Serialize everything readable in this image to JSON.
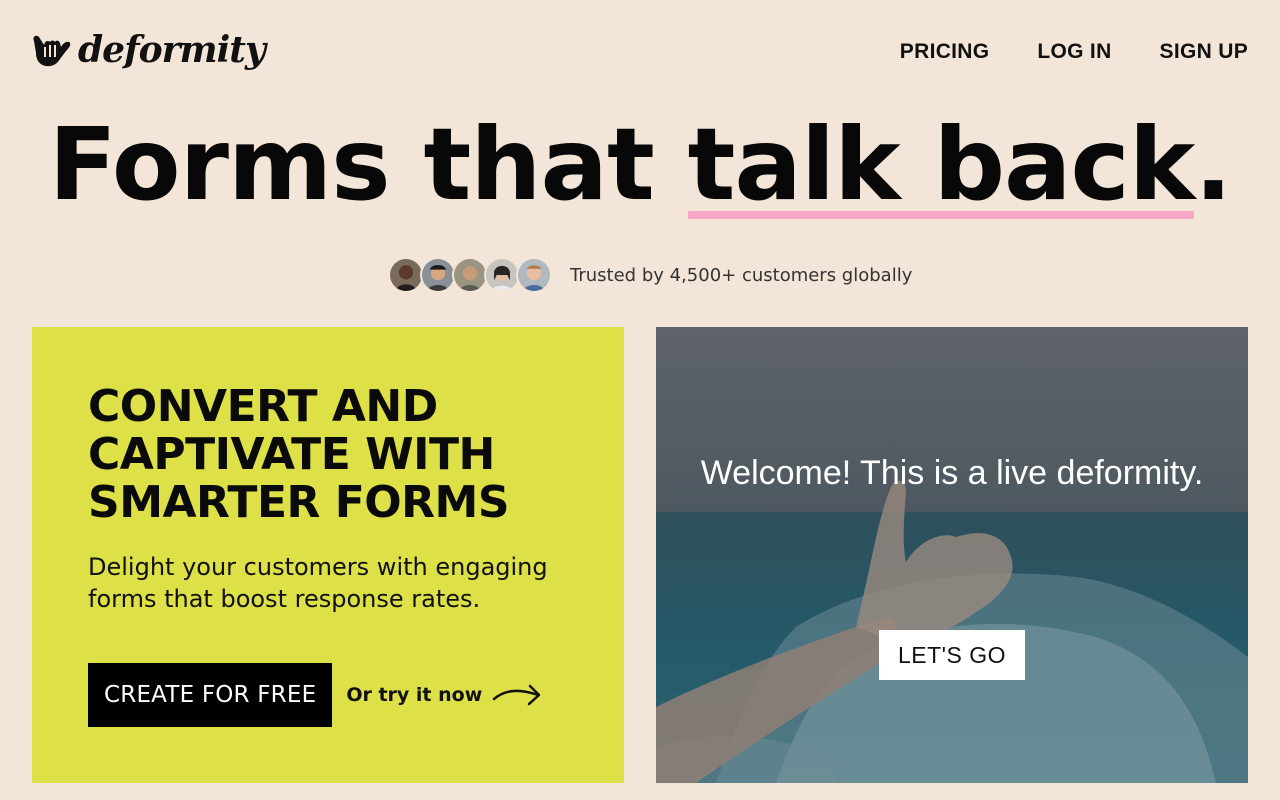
{
  "brand": {
    "name": "deformity",
    "icon": "shaka-hand-icon"
  },
  "nav": {
    "items": [
      {
        "label": "PRICING"
      },
      {
        "label": "LOG IN"
      },
      {
        "label": "SIGN UP"
      }
    ]
  },
  "hero": {
    "title_pre": "Forms that ",
    "title_highlight": "talk back",
    "title_post": ".",
    "highlight_color": "#f7a6c4"
  },
  "trust": {
    "text": "Trusted by 4,500+ customers globally",
    "avatar_count": 5
  },
  "promo": {
    "heading": "CONVERT AND CAPTIVATE WITH SMARTER FORMS",
    "description": "Delight your customers with engaging forms that boost response rates.",
    "cta_label": "CREATE FOR FREE",
    "try_label": "Or try it now",
    "background": "#dde046"
  },
  "demo": {
    "welcome": "Welcome! This is a live deformity.",
    "button_label": "LET'S GO"
  },
  "colors": {
    "page_background": "#f3e6d8",
    "accent_pink": "#f7a6c4",
    "cta_background": "#000000"
  }
}
